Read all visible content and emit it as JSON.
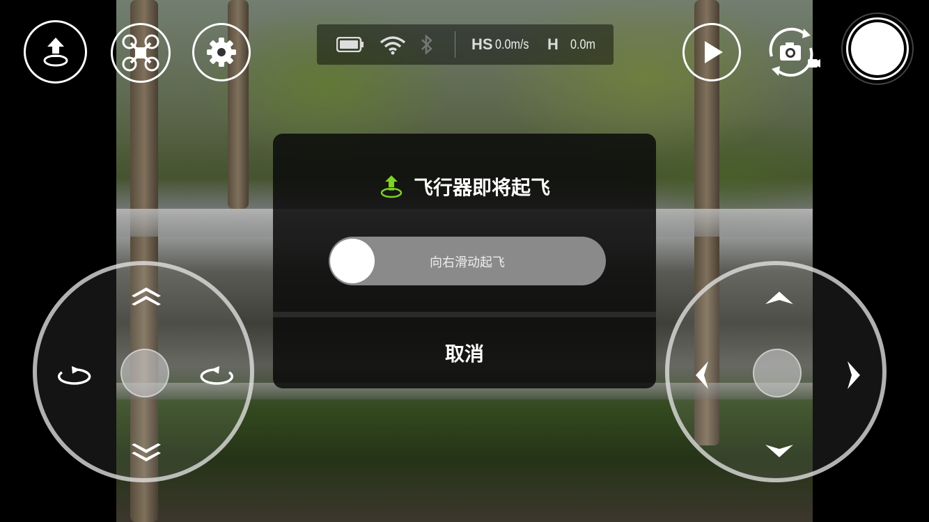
{
  "status_bar": {
    "hs_label": "HS",
    "hs_value": "0.0m/s",
    "h_label": "H",
    "h_value": "0.0m"
  },
  "top_buttons": {
    "left": [
      "takeoff-icon",
      "drone-icon",
      "gear-icon"
    ],
    "right": [
      "play-icon",
      "camera-switch-icon",
      "shutter-button"
    ]
  },
  "dialog": {
    "title": "飞行器即将起飞",
    "slider_label": "向右滑动起飞",
    "cancel_label": "取消",
    "accent_color": "#7fd321"
  },
  "left_joystick": {
    "icons": [
      "ascend-icon",
      "descend-icon",
      "rotate-left-icon",
      "rotate-right-icon"
    ]
  },
  "right_joystick": {
    "icons": [
      "forward-icon",
      "backward-icon",
      "left-icon",
      "right-icon"
    ]
  }
}
